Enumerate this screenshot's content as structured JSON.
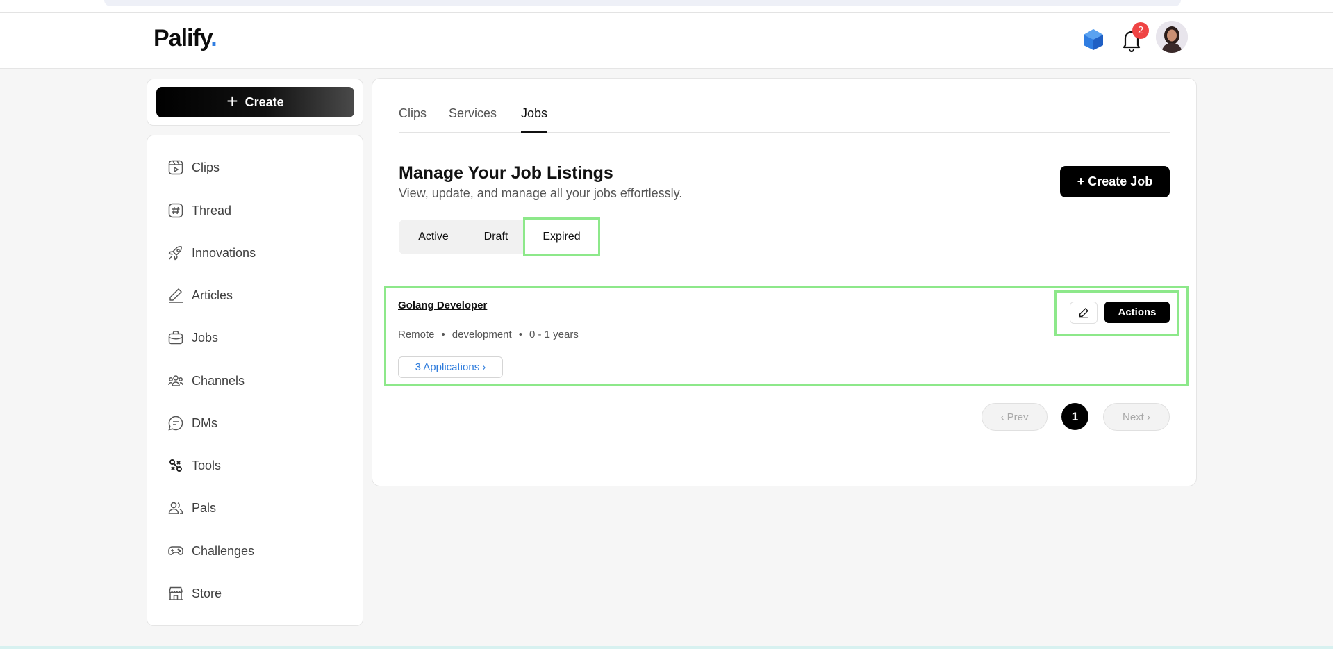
{
  "app": {
    "logo_text": "Palify",
    "logo_dot": "."
  },
  "header": {
    "notification_count": "2"
  },
  "create": {
    "label": "Create"
  },
  "sidebar": {
    "items": [
      {
        "label": "Clips",
        "icon": "clips-icon"
      },
      {
        "label": "Thread",
        "icon": "hash-icon"
      },
      {
        "label": "Innovations",
        "icon": "rocket-icon"
      },
      {
        "label": "Articles",
        "icon": "pen-icon"
      },
      {
        "label": "Jobs",
        "icon": "briefcase-icon"
      },
      {
        "label": "Channels",
        "icon": "users-icon"
      },
      {
        "label": "DMs",
        "icon": "chat-icon"
      },
      {
        "label": "Tools",
        "icon": "tools-icon"
      },
      {
        "label": "Pals",
        "icon": "pals-icon"
      },
      {
        "label": "Challenges",
        "icon": "gamepad-icon"
      },
      {
        "label": "Store",
        "icon": "store-icon"
      }
    ]
  },
  "tabs": [
    {
      "label": "Clips"
    },
    {
      "label": "Services"
    },
    {
      "label": "Jobs",
      "active": true
    }
  ],
  "main": {
    "title": "Manage Your Job Listings",
    "subtitle": "View, update, and manage all your jobs effortlessly.",
    "create_job_label": "+ Create Job"
  },
  "filters": [
    {
      "label": "Active"
    },
    {
      "label": "Draft"
    },
    {
      "label": "Expired",
      "selected": true
    }
  ],
  "jobs": [
    {
      "title": "Golang Developer",
      "location": "Remote",
      "category": "development",
      "experience": "0 - 1 years",
      "applications_label": "3 Applications",
      "actions_label": "Actions"
    }
  ],
  "pagination": {
    "prev_label": "Prev",
    "current": "1",
    "next_label": "Next"
  },
  "colors": {
    "highlight": "#8de88a",
    "link": "#2d7bdc",
    "badge": "#ef4444",
    "brand_dot": "#2f7de1"
  }
}
